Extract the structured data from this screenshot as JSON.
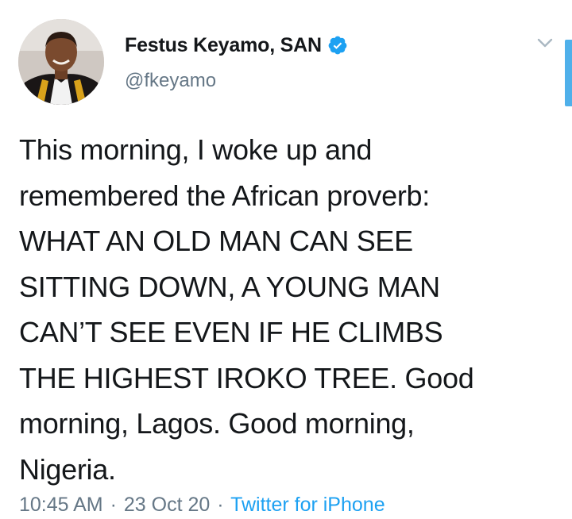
{
  "author": {
    "display_name": "Festus Keyamo, SAN",
    "handle": "@fkeyamo",
    "verified": true,
    "avatar_icon": "profile-photo"
  },
  "tweet": {
    "text": "This morning, I woke up and\nremembered the African proverb:\nWHAT AN OLD MAN CAN SEE\nSITTING DOWN, A YOUNG MAN\nCAN’T SEE EVEN IF HE CLIMBS\nTHE HIGHEST IROKO TREE. Good\nmorning, Lagos. Good morning,\nNigeria."
  },
  "meta": {
    "time": "10:45 AM",
    "separator": "·",
    "date": "23 Oct 20",
    "source": "Twitter for iPhone"
  },
  "colors": {
    "text": "#14171a",
    "secondary": "#657786",
    "accent": "#1da1f2",
    "scrollbar": "#4fb0ea"
  },
  "icons": {
    "verified": "verified-badge-icon",
    "menu": "chevron-down-icon"
  }
}
